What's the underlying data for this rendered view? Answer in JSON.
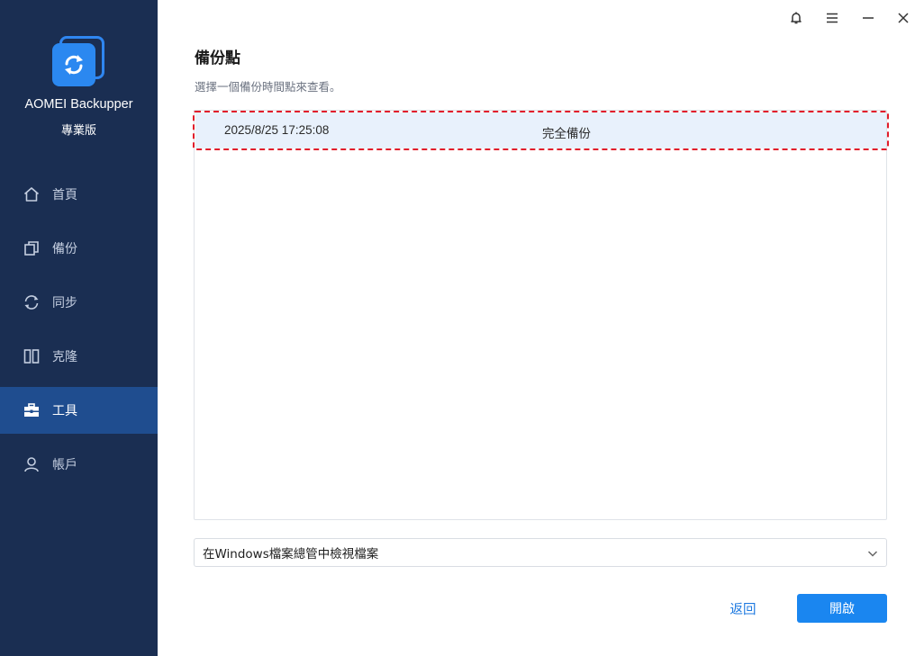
{
  "app": {
    "name": "AOMEI Backupper",
    "edition": "專業版",
    "logo_icon": "backup-arrows-icon",
    "colors": {
      "sidebar_bg": "#1a2e52",
      "sidebar_active": "#1f4d8f",
      "accent": "#1a86f0",
      "highlight_border": "#e11d2b"
    }
  },
  "sidebar": {
    "items": [
      {
        "label": "首頁",
        "icon": "home-icon",
        "active": false
      },
      {
        "label": "備份",
        "icon": "copy-icon",
        "active": false
      },
      {
        "label": "同步",
        "icon": "sync-icon",
        "active": false
      },
      {
        "label": "克隆",
        "icon": "clone-icon",
        "active": false
      },
      {
        "label": "工具",
        "icon": "toolbox-icon",
        "active": true
      },
      {
        "label": "帳戶",
        "icon": "user-icon",
        "active": false
      }
    ]
  },
  "titlebar": {
    "buttons": [
      "bell-icon",
      "menu-icon",
      "minimize-icon",
      "close-icon"
    ]
  },
  "main": {
    "title": "備份點",
    "description": "選擇一個備份時間點來查看。",
    "backup_points": [
      {
        "time": "2025/8/25 17:25:08",
        "type": "完全備份",
        "selected": true
      }
    ],
    "view_option": {
      "selected": "在Windows檔案總管中檢視檔案"
    },
    "back_label": "返回",
    "open_label": "開啟"
  }
}
